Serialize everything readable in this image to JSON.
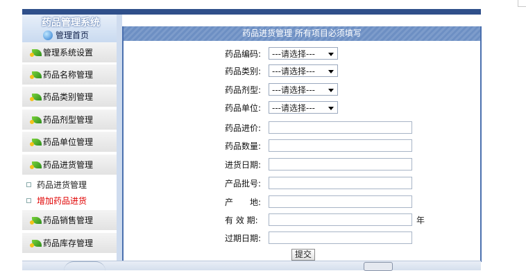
{
  "app": {
    "system_title": "药品管理系统",
    "home_label": "管理首页"
  },
  "sidebar": {
    "items": [
      {
        "label": "管理系统设置"
      },
      {
        "label": "药品名称管理"
      },
      {
        "label": "药品类别管理"
      },
      {
        "label": "药品剂型管理"
      },
      {
        "label": "药品单位管理"
      },
      {
        "label": "药品进货管理"
      }
    ],
    "sub_items": [
      {
        "label": "药品进货管理",
        "color": "#111111"
      },
      {
        "label": "增加药品进货",
        "color": "#e00000"
      }
    ],
    "bottom_items": [
      {
        "label": "药品销售管理"
      },
      {
        "label": "药品库存管理"
      }
    ]
  },
  "form": {
    "header": "药品进货管理 所有项目必须填写",
    "select_fields": [
      {
        "label": "药品编码:",
        "value": "---请选择---"
      },
      {
        "label": "药品类别:",
        "value": "---请选择---"
      },
      {
        "label": "药品剂型:",
        "value": "---请选择---"
      },
      {
        "label": "药品单位:",
        "value": "---请选择---"
      }
    ],
    "text_fields": [
      {
        "label": "药品进价:",
        "value": ""
      },
      {
        "label": "药品数量:",
        "value": ""
      },
      {
        "label": "进货日期:",
        "value": ""
      },
      {
        "label": "产品批号:",
        "value": ""
      },
      {
        "label": "产　　地:",
        "value": ""
      },
      {
        "label": "有 效 期:",
        "value": "",
        "unit": "年"
      },
      {
        "label": "过期日期:",
        "value": ""
      }
    ],
    "submit_label": "提交"
  },
  "colors": {
    "accent": "#4a6fae",
    "topbar": "#2f4f8a",
    "highlight_text": "#e00000"
  }
}
